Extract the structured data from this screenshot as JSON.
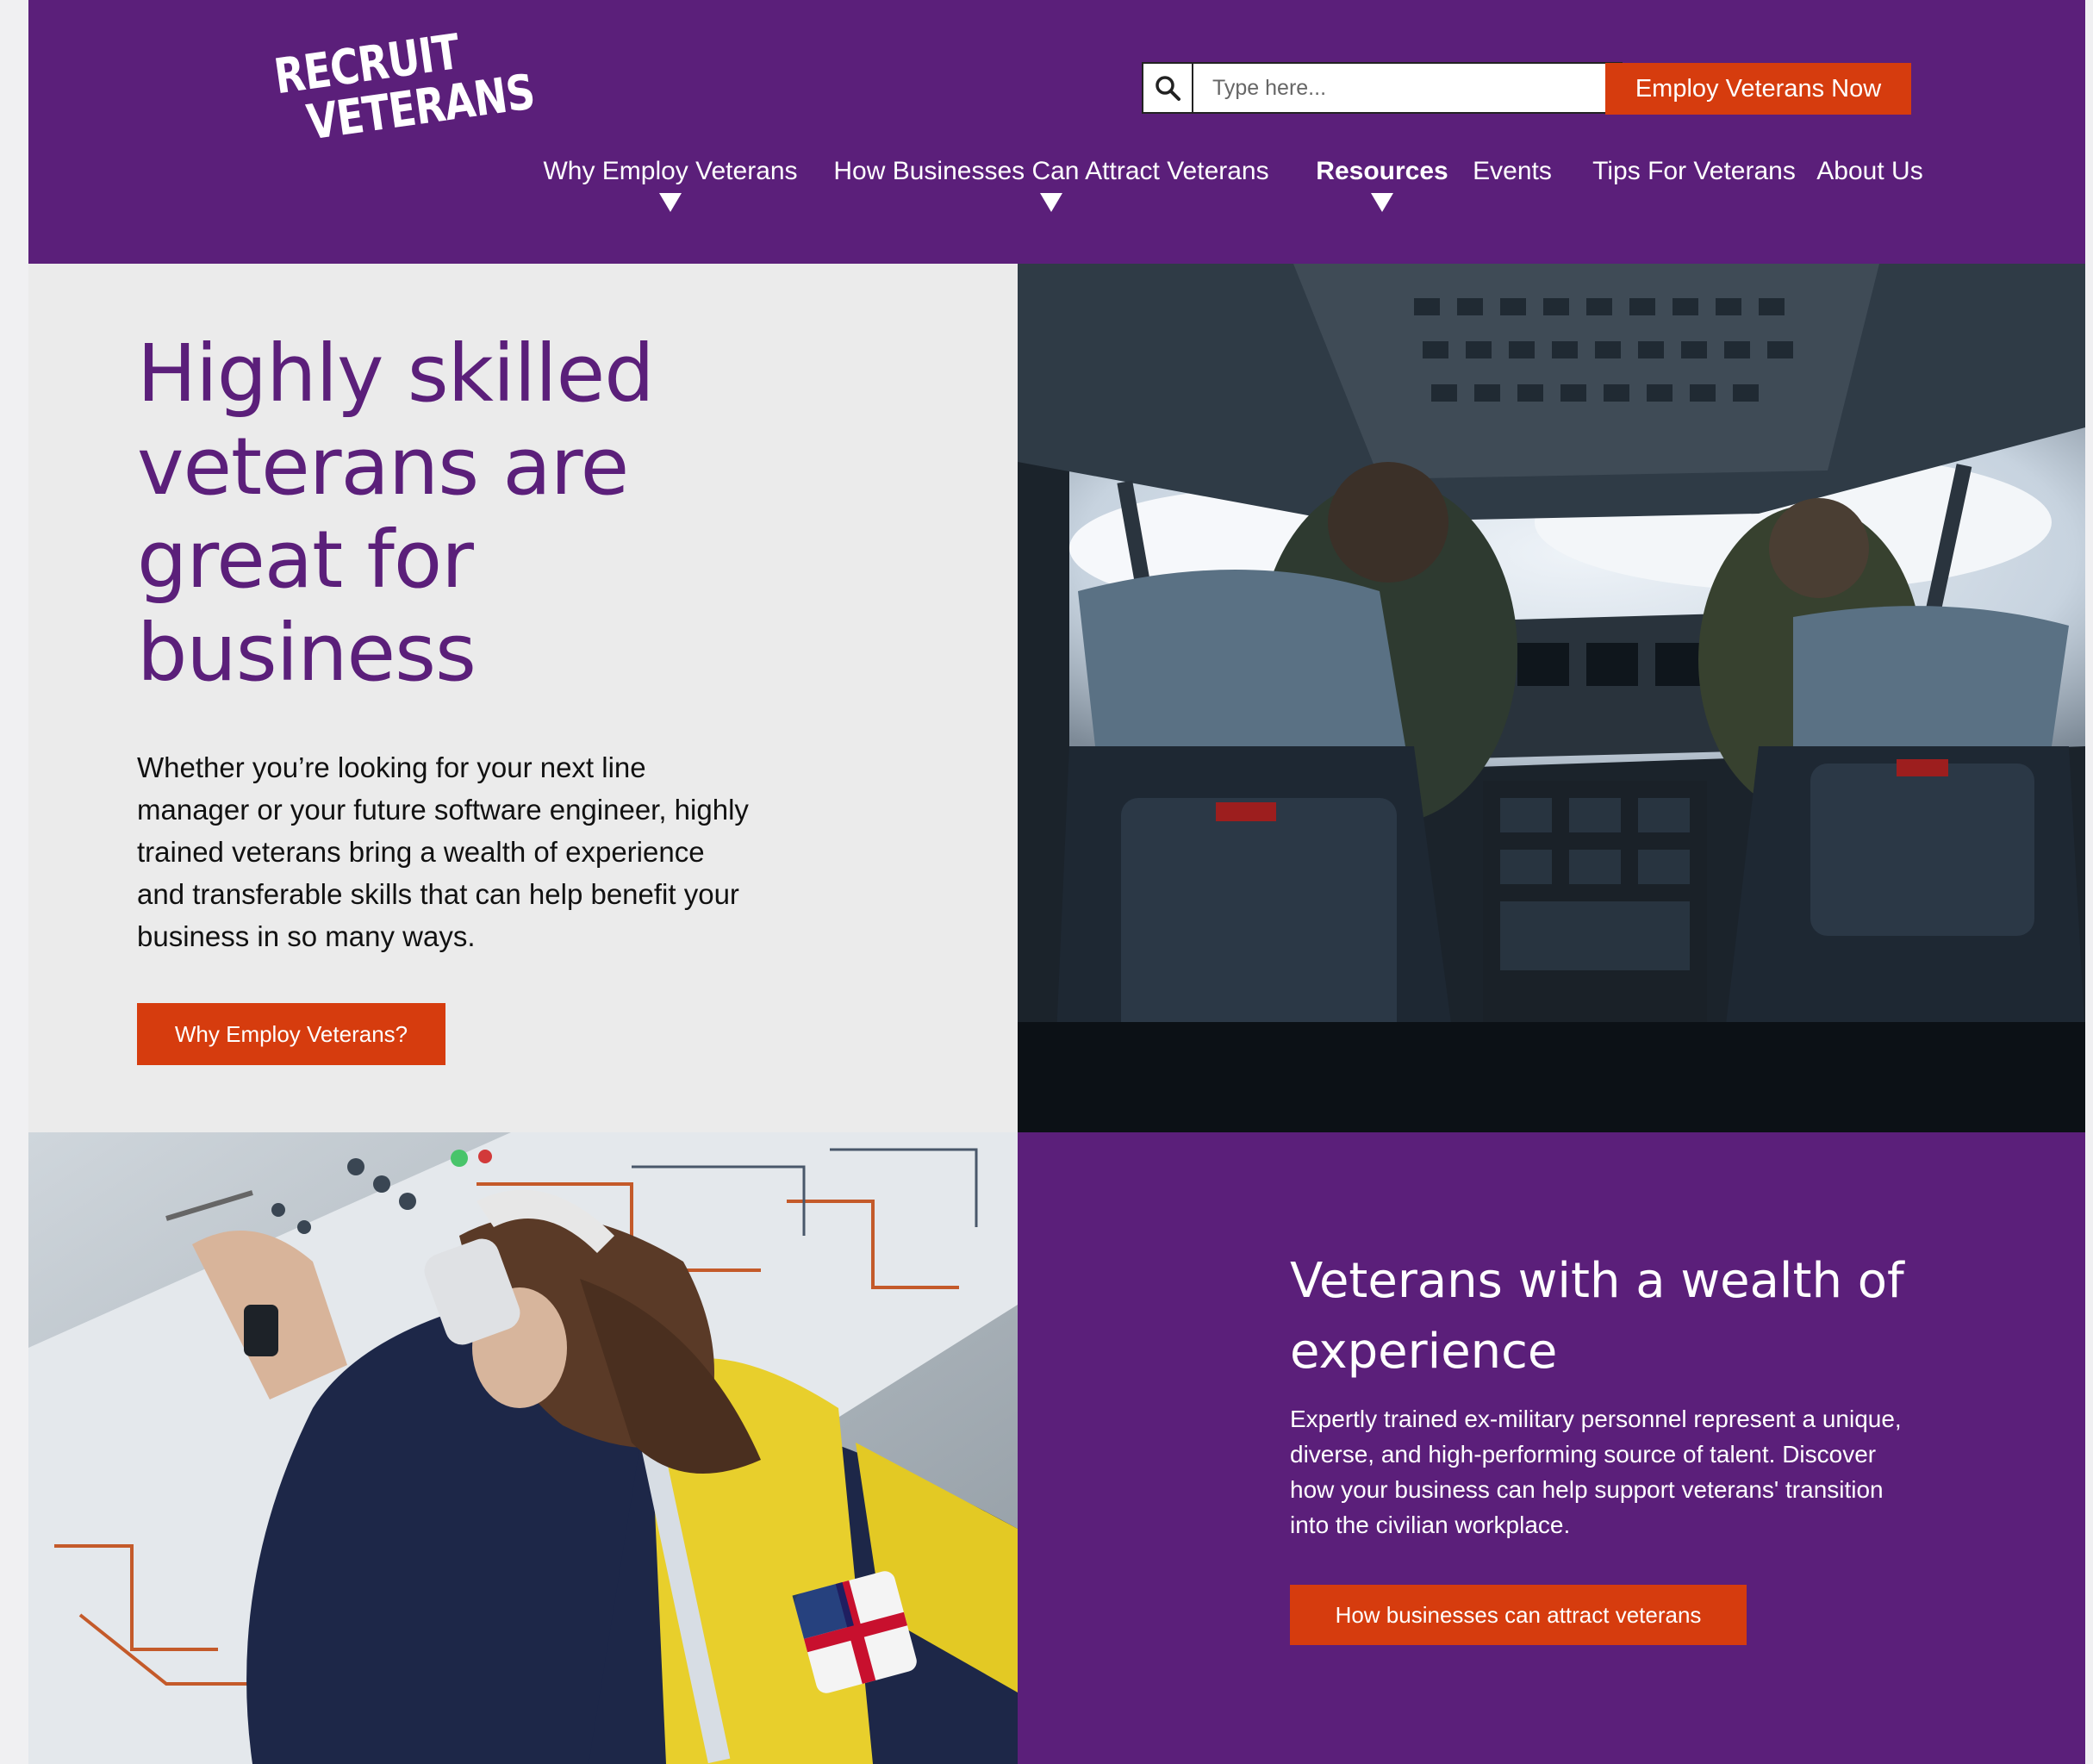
{
  "brand": {
    "logo_line1": "RECRUIT",
    "logo_line2": "VETERANS",
    "primary_color": "#5b1f7a",
    "accent_color": "#d63c0e"
  },
  "header": {
    "search": {
      "placeholder": "Type here...",
      "icon": "search-icon"
    },
    "cta_label": "Employ Veterans Now"
  },
  "nav": {
    "items": [
      {
        "label": "Why Employ Veterans",
        "has_dropdown": true
      },
      {
        "label": "How Businesses Can Attract Veterans",
        "has_dropdown": true
      },
      {
        "label": "Resources",
        "has_dropdown": true,
        "active": true
      },
      {
        "label": "Events",
        "has_dropdown": false
      },
      {
        "label": "Tips For Veterans",
        "has_dropdown": false
      },
      {
        "label": "About Us",
        "has_dropdown": false
      }
    ]
  },
  "hero": {
    "title": "Highly skilled veterans are great for business",
    "body": "Whether you’re looking for your next line manager or your future software engineer, highly trained veterans bring a wealth of experience and transferable skills that can help benefit your business in so many ways.",
    "button_label": "Why Employ Veterans?"
  },
  "experience": {
    "title": "Veterans with a wealth of experience",
    "body": "Expertly trained ex-military personnel represent a unique, diverse, and high-performing source of talent. Discover how your business can help support veterans' transition into the civilian workplace.",
    "button_label": "How businesses can attract veterans"
  }
}
